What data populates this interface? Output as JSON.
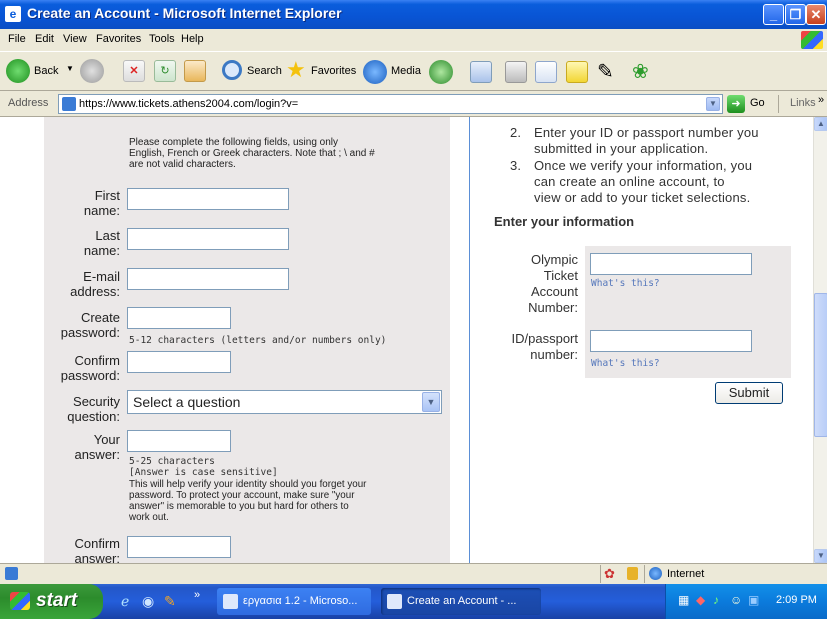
{
  "window": {
    "title": "Create an Account - Microsoft Internet Explorer"
  },
  "menu": [
    "File",
    "Edit",
    "View",
    "Favorites",
    "Tools",
    "Help"
  ],
  "toolbar": {
    "back": "Back",
    "search": "Search",
    "favorites": "Favorites",
    "media": "Media"
  },
  "address": {
    "label": "Address",
    "url": "https://www.tickets.athens2004.com/login?v=",
    "go": "Go",
    "links": "Links"
  },
  "form": {
    "intro": [
      "Please complete the following fields, using only",
      "English, French or Greek characters. Note that ; \\ and #",
      "are not valid characters."
    ],
    "first_name": [
      "First",
      "name:"
    ],
    "last_name": [
      "Last",
      "name:"
    ],
    "email": [
      "E-mail",
      "address:"
    ],
    "create_password": [
      "Create",
      "password:"
    ],
    "password_hint": "5-12 characters (letters and/or numbers only)",
    "confirm_password": [
      "Confirm",
      "password:"
    ],
    "security_question": [
      "Security",
      "question:"
    ],
    "security_select": "Select a question",
    "your_answer": [
      "Your",
      "answer:"
    ],
    "answer_notes": [
      "5-25 characters",
      "[Answer is case sensitive]"
    ],
    "answer_help": [
      "This will help verify your identity should you forget your",
      "password. To protect your account, make sure \"your",
      "answer\" is memorable to you but hard for others to",
      "work out."
    ],
    "confirm_answer": [
      "Confirm",
      "answer:"
    ]
  },
  "right": {
    "steps": [
      {
        "num": "2.",
        "lines": [
          "Enter your ID or passport number you",
          "submitted in your application."
        ]
      },
      {
        "num": "3.",
        "lines": [
          "Once we verify your information, you",
          "can create an online account, to",
          "view or add to your ticket selections."
        ]
      }
    ],
    "heading": "Enter your information",
    "olympic_label": [
      "Olympic",
      "Ticket",
      "Account",
      "Number:"
    ],
    "whats_this": "What's this?",
    "id_label": [
      "ID/passport",
      "number:"
    ],
    "submit": "Submit"
  },
  "status": {
    "zone": "Internet"
  },
  "taskbar": {
    "start": "start",
    "tasks": [
      "εργασια 1.2 - Microso...",
      "Create an Account - ..."
    ],
    "clock": "2:09 PM"
  }
}
